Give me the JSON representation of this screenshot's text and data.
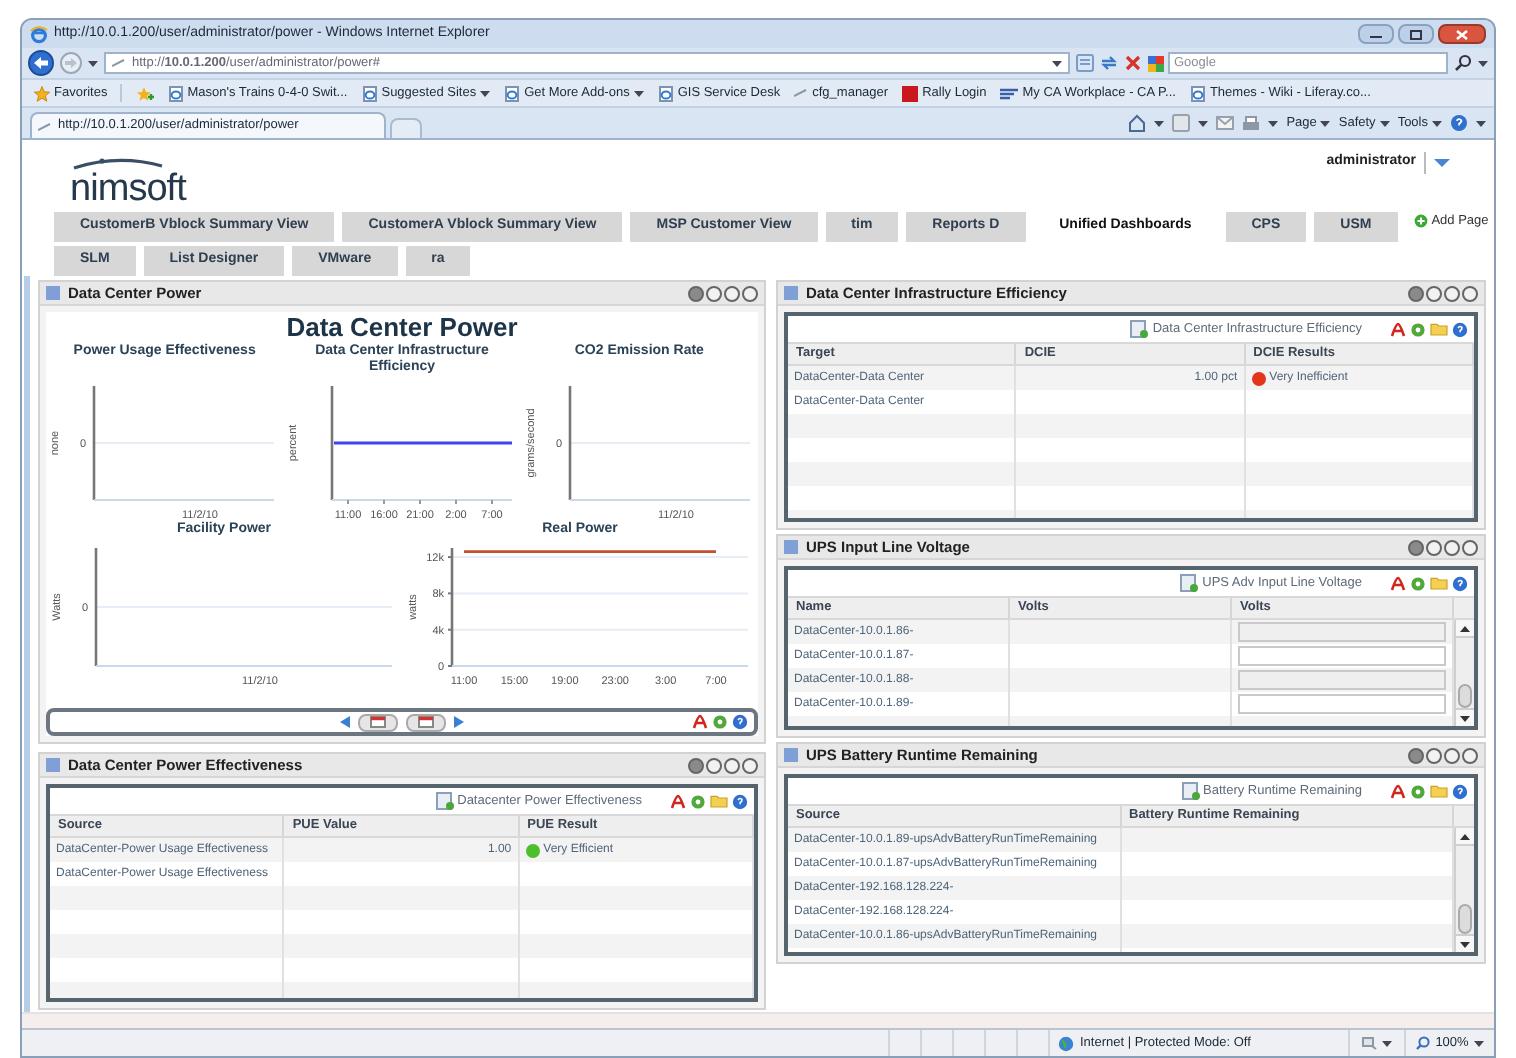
{
  "browser": {
    "title": "http://10.0.1.200/user/administrator/power - Windows Internet Explorer",
    "address": "http://**10.0.1.200**/user/administrator/power#",
    "search_placeholder": "Google",
    "favorites_label": "Favorites",
    "favorites": [
      {
        "kind": "page",
        "label": "Mason's Trains 0-4-0 Swit...",
        "dropdown": false
      },
      {
        "kind": "page",
        "label": "Suggested Sites",
        "dropdown": true
      },
      {
        "kind": "page",
        "label": "Get More Add-ons",
        "dropdown": true
      },
      {
        "kind": "page",
        "label": "GIS Service Desk",
        "dropdown": false
      },
      {
        "kind": "link",
        "label": "cfg_manager",
        "dropdown": false
      },
      {
        "kind": "rally",
        "label": "Rally Login",
        "dropdown": false
      },
      {
        "kind": "workplace",
        "label": "My CA Workplace - CA P...",
        "dropdown": false
      },
      {
        "kind": "page",
        "label": "Themes - Wiki - Liferay.co...",
        "dropdown": false
      }
    ],
    "tab_title": "http://10.0.1.200/user/administrator/power",
    "commands": [
      "Page",
      "Safety",
      "Tools"
    ]
  },
  "page": {
    "logo": "nimsoft",
    "user": "administrator",
    "add_page": "Add Page",
    "tabs": [
      {
        "label": "CustomerB Vblock Summary View",
        "selected": false
      },
      {
        "label": "CustomerA Vblock Summary View",
        "selected": false
      },
      {
        "label": "MSP Customer View",
        "selected": false
      },
      {
        "label": "tim",
        "selected": false
      },
      {
        "label": "Reports D",
        "selected": false
      },
      {
        "label": "Unified Dashboards",
        "selected": true
      },
      {
        "label": "CPS",
        "selected": false
      },
      {
        "label": "USM",
        "selected": false
      }
    ],
    "subtabs": [
      {
        "label": "SLM",
        "selected": false
      },
      {
        "label": "List Designer",
        "selected": false
      },
      {
        "label": "VMware",
        "selected": false
      },
      {
        "label": "ra",
        "selected": false
      }
    ]
  },
  "portlets_left": [
    {
      "kind": "charts",
      "title": "Data Center Power",
      "heading": "Data Center Power",
      "charts": [
        {
          "kind": "empty",
          "title": "Power Usage Effectiveness",
          "ylabel": "none",
          "yticks": [
            "0"
          ],
          "xticks": [
            "11/2/10"
          ]
        },
        {
          "kind": "flat_line",
          "title": "Data Center Infrastructure Efficiency",
          "ylabel": "percent",
          "xticks": [
            "11:00",
            "16:00",
            "21:00",
            "2:00",
            "7:00"
          ]
        },
        {
          "kind": "empty",
          "title": "CO2 Emission Rate",
          "ylabel": "grams/second",
          "yticks": [
            "0"
          ],
          "xticks": [
            "11/2/10"
          ]
        },
        {
          "kind": "empty",
          "title": "Facility Power",
          "ylabel": "Watts",
          "yticks": [
            "0"
          ],
          "xticks": [
            "11/2/10"
          ]
        },
        {
          "kind": "line",
          "chart_data": {
            "type": "line",
            "title": "Real Power",
            "ylabel": "watts",
            "categories": [
              "11:00",
              "15:00",
              "19:00",
              "23:00",
              "3:00",
              "7:00"
            ],
            "grid": true,
            "series": [
              {
                "color": "#c0502f",
                "values": [
                  12600,
                  12600,
                  12600,
                  12600,
                  12600,
                  12600
                ]
              }
            ],
            "ylim": [
              0,
              13000
            ],
            "yticks": [
              {
                "value": 0,
                "label": "0"
              },
              {
                "value": 4000,
                "label": "4k"
              },
              {
                "value": 8000,
                "label": "8k"
              },
              {
                "value": 12000,
                "label": "12k"
              }
            ]
          }
        }
      ]
    },
    {
      "kind": "table",
      "title": "Data Center Power Effectiveness",
      "report": "Datacenter Power Effectiveness",
      "columns": [
        {
          "label": "Source",
          "kind": "text"
        },
        {
          "label": "PUE Value",
          "kind": "number"
        },
        {
          "label": "PUE Result",
          "kind": "result"
        }
      ],
      "rows": [
        {
          "cells": [
            "DataCenter-Power Usage Effectiveness",
            "1.00",
            "Very Efficient"
          ],
          "color": "#4cbf2a"
        },
        {
          "cells": [
            "DataCenter-Power Usage Effectiveness"
          ]
        }
      ]
    }
  ],
  "portlets_right": [
    {
      "kind": "table",
      "title": "Data Center Infrastructure Efficiency",
      "report": "Data Center Infrastructure Efficiency",
      "columns": [
        {
          "label": "Target",
          "kind": "text"
        },
        {
          "label": "DCIE",
          "kind": "number"
        },
        {
          "label": "DCIE Results",
          "kind": "result"
        }
      ],
      "rows": [
        {
          "cells": [
            "DataCenter-Data Center",
            "1.00 pct",
            "Very Inefficient"
          ],
          "color": "#e3341c"
        },
        {
          "cells": [
            "DataCenter-Data Center"
          ]
        }
      ]
    },
    {
      "kind": "scroll_table",
      "title": "UPS Input Line Voltage",
      "report": "UPS Adv Input Line Voltage",
      "columns": [
        {
          "label": "Name",
          "kind": "text"
        },
        {
          "label": "Volts",
          "kind": "text"
        },
        {
          "label": "Volts",
          "kind": "field"
        }
      ],
      "rows": [
        {
          "cells": [
            "DataCenter-10.0.1.86-"
          ]
        },
        {
          "cells": [
            "DataCenter-10.0.1.87-"
          ]
        },
        {
          "cells": [
            "DataCenter-10.0.1.88-"
          ]
        },
        {
          "cells": [
            "DataCenter-10.0.1.89-"
          ]
        }
      ]
    },
    {
      "kind": "scroll_table",
      "title": "UPS Battery Runtime Remaining",
      "report": "Battery Runtime Remaining",
      "columns": [
        {
          "label": "Source",
          "kind": "text"
        },
        {
          "label": "Battery Runtime Remaining",
          "kind": "text"
        }
      ],
      "rows": [
        {
          "cells": [
            "DataCenter-10.0.1.89-upsAdvBatteryRunTimeRemaining"
          ]
        },
        {
          "cells": [
            "DataCenter-10.0.1.87-upsAdvBatteryRunTimeRemaining"
          ]
        },
        {
          "cells": [
            "DataCenter-192.168.128.224-"
          ]
        },
        {
          "cells": [
            "DataCenter-192.168.128.224-"
          ]
        },
        {
          "cells": [
            "DataCenter-10.0.1.86-upsAdvBatteryRunTimeRemaining"
          ]
        }
      ]
    }
  ],
  "status_bar": {
    "zone": "Internet | Protected Mode: Off",
    "zoom": "100%"
  }
}
